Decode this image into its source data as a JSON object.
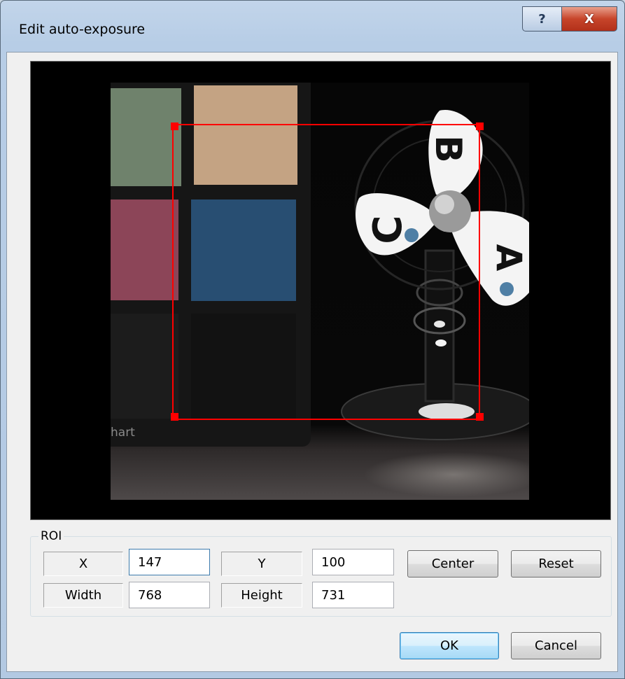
{
  "window": {
    "title": "Edit auto-exposure",
    "help_glyph": "?",
    "close_glyph": "X"
  },
  "preview": {
    "chart_text": "hart",
    "fan_letters": [
      "B",
      "C",
      "A"
    ]
  },
  "roi": {
    "group_label": "ROI",
    "x_label": "X",
    "x_value": "147",
    "y_label": "Y",
    "y_value": "100",
    "width_label": "Width",
    "width_value": "768",
    "height_label": "Height",
    "height_value": "731",
    "center_label": "Center",
    "reset_label": "Reset"
  },
  "footer": {
    "ok_label": "OK",
    "cancel_label": "Cancel"
  },
  "colors": {
    "roi_outline": "#ff0000",
    "default_button_border": "#3c7fb1"
  }
}
